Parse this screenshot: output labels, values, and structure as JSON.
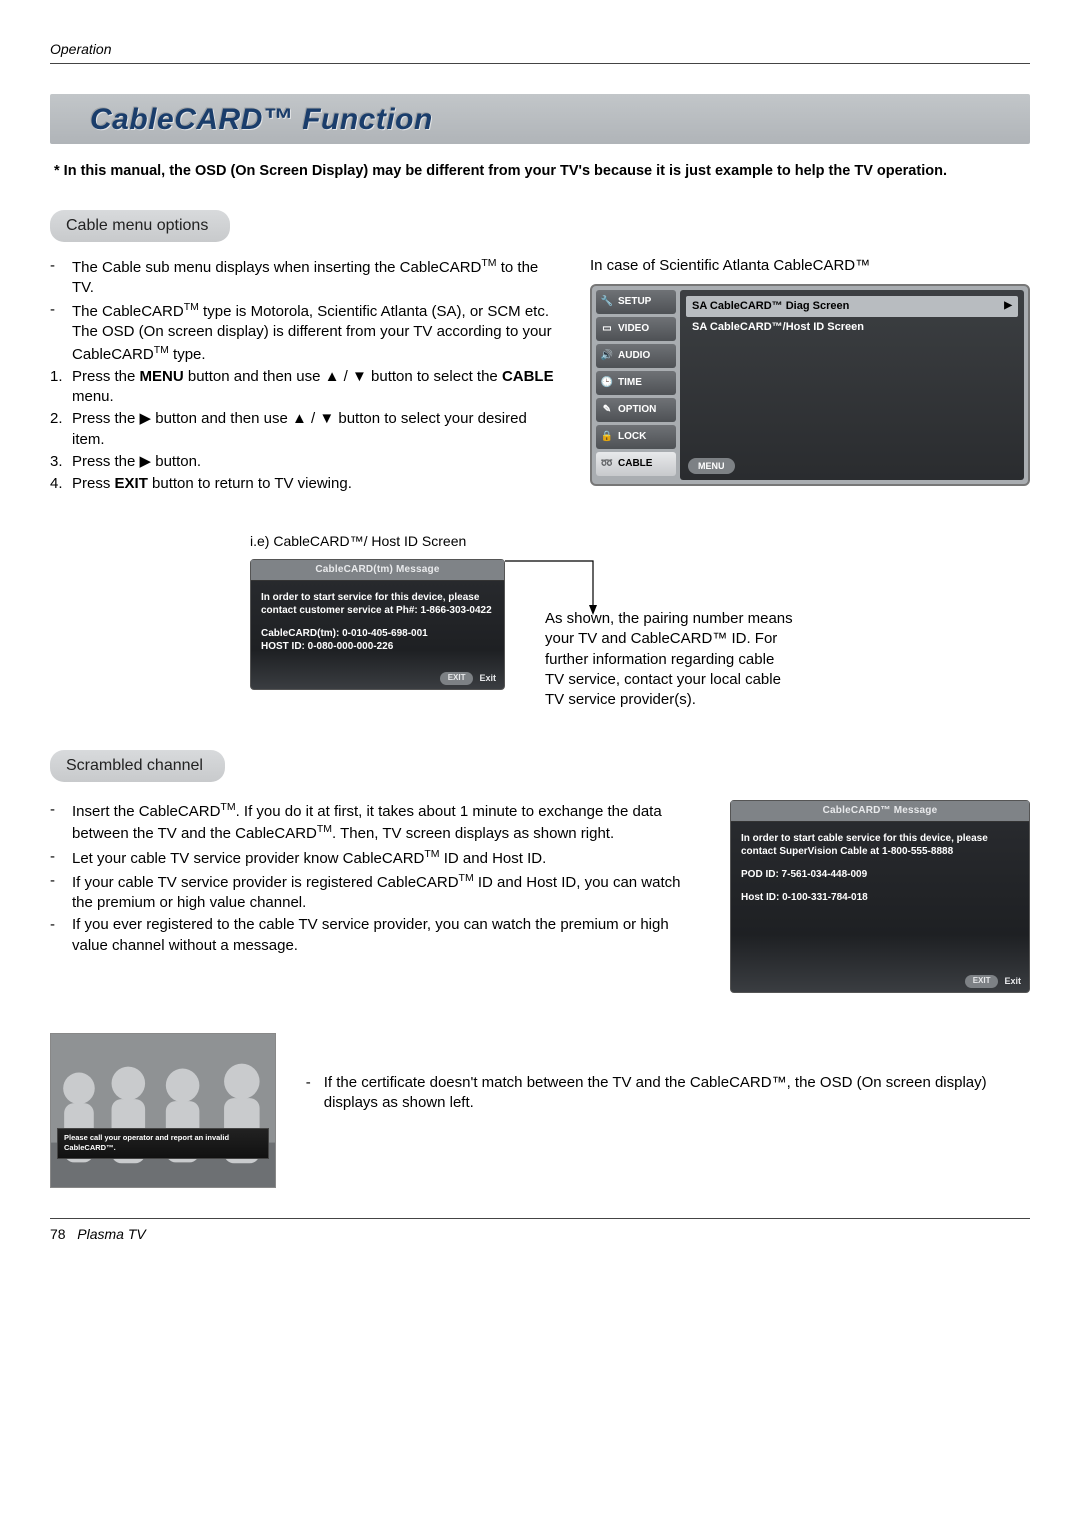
{
  "header": {
    "label": "Operation"
  },
  "title": "CableCARD™ Function",
  "note": "* In this manual, the OSD (On Screen Display) may be different from your TV's because it is just example to help the TV operation.",
  "section1": {
    "heading": "Cable menu options",
    "items": {
      "d1a": "The Cable sub menu displays when inserting the CableCARD",
      "d1b": " to the TV.",
      "d2a": "The CableCARD",
      "d2b": " type is Motorola, Scientific Atlanta (SA), or SCM etc. The OSD (On screen display) is different from your TV according to your CableCARD",
      "d2c": " type.",
      "s1a": "Press the ",
      "s1b": "MENU",
      "s1c": " button and then use ▲ / ▼ button to select the ",
      "s1d": "CABLE",
      "s1e": " menu.",
      "s2": "Press the ▶ button and then use ▲ / ▼ button to select your desired item.",
      "s3": "Press the ▶ button.",
      "s4a": "Press ",
      "s4b": "EXIT",
      "s4c": " button to return to TV viewing."
    },
    "right_caption": "In case of Scientific Atlanta CableCARD™"
  },
  "tvmenu": {
    "tabs": [
      "SETUP",
      "VIDEO",
      "AUDIO",
      "TIME",
      "OPTION",
      "LOCK",
      "CABLE"
    ],
    "selected_index": 6,
    "lines": [
      "SA CableCARD™ Diag Screen",
      "SA CableCARD™/Host ID Screen"
    ],
    "menu_btn": "MENU"
  },
  "hostid": {
    "caption": "i.e) CableCARD™/ Host ID Screen",
    "header": "CableCARD(tm) Message",
    "body1": "In order to start service for this device, please contact customer service at Ph#: 1-866-303-0422",
    "body2": "CableCARD(tm): 0-010-405-698-001",
    "body3": "HOST ID: 0-080-000-000-226",
    "exit_pill": "EXIT",
    "exit_label": "Exit",
    "desc": "As shown, the pairing number means your TV and CableCARD™ ID. For further information regarding cable TV service, contact your local cable TV service provider(s)."
  },
  "section2": {
    "heading": "Scrambled channel",
    "b1a": "Insert the CableCARD",
    "b1b": ". If you do it at first, it takes about 1 minute to exchange the data between the TV and the CableCARD",
    "b1c": ". Then, TV screen displays as shown right.",
    "b2a": "Let your cable TV service provider know CableCARD",
    "b2b": " ID and Host ID.",
    "b3a": "If your cable TV service provider is registered CableCARD",
    "b3b": " ID and Host ID, you can watch the premium or high value channel.",
    "b4": "If you ever registered to the cable TV service provider, you can watch the premium or high value channel without a message."
  },
  "osd2": {
    "header": "CableCARD™ Message",
    "body1": "In order to start cable service for this device, please contact SuperVision Cable at 1-800-555-8888",
    "body2": "POD ID: 7-561-034-448-009",
    "body3": "Host ID: 0-100-331-784-018",
    "exit_pill": "EXIT",
    "exit_label": "Exit"
  },
  "invalid": {
    "banner": "Please call your operator and report an invalid CableCARD™.",
    "note": "If the certificate doesn't match between the TV and the CableCARD™, the OSD (On screen display) displays as shown left."
  },
  "footer": {
    "page": "78",
    "product": "Plasma TV"
  },
  "tm": "TM"
}
